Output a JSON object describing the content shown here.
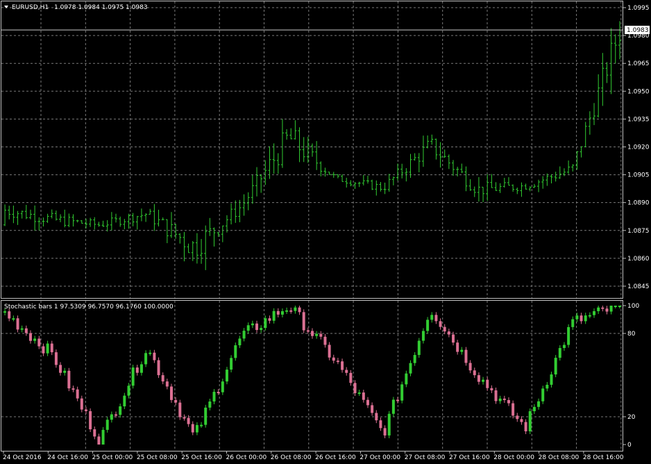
{
  "header": {
    "symbol_label": "EURUSD,H1",
    "ohlc_label": "1.0978 1.0984 1.0975 1.0983",
    "menu_icon": "triangle-down-icon"
  },
  "price_panel": {
    "current_price_label": "1.0983",
    "current_price": 1.0983,
    "y_ticks": [
      {
        "value": 1.0995,
        "label": "1.0995"
      },
      {
        "value": 1.098,
        "label": "1.0980"
      },
      {
        "value": 1.0965,
        "label": "1.0965"
      },
      {
        "value": 1.095,
        "label": "1.0950"
      },
      {
        "value": 1.0935,
        "label": "1.0935"
      },
      {
        "value": 1.092,
        "label": "1.0920"
      },
      {
        "value": 1.0905,
        "label": "1.0905"
      },
      {
        "value": 1.089,
        "label": "1.0890"
      },
      {
        "value": 1.0875,
        "label": "1.0875"
      },
      {
        "value": 1.086,
        "label": "1.0860"
      },
      {
        "value": 1.0845,
        "label": "1.0845"
      }
    ]
  },
  "stoch_panel": {
    "title": "Stochastic bars 1 97.5309 96.7570 96.1760 100.0000",
    "y_ticks": [
      {
        "value": 100,
        "label": "100"
      },
      {
        "value": 80,
        "label": "80"
      },
      {
        "value": 20,
        "label": "20"
      },
      {
        "value": 0,
        "label": "0"
      }
    ]
  },
  "x_axis": {
    "labels": [
      "24 Oct 2016",
      "24 Oct 16:00",
      "25 Oct 00:00",
      "25 Oct 08:00",
      "25 Oct 16:00",
      "26 Oct 00:00",
      "26 Oct 08:00",
      "26 Oct 16:00",
      "27 Oct 00:00",
      "27 Oct 08:00",
      "27 Oct 16:00",
      "28 Oct 00:00",
      "28 Oct 08:00",
      "28 Oct 16:00"
    ]
  },
  "colors": {
    "background": "#000000",
    "grid": "#7a7a7a",
    "border": "#c0c0c0",
    "price_bar": "#32cd32",
    "stoch_up": "#32cd32",
    "stoch_down": "#db7093",
    "text": "#ffffff"
  },
  "chart_data": [
    {
      "type": "bar",
      "x": [
        "24 Oct 2016",
        "24 Oct 16:00",
        "25 Oct 00:00",
        "25 Oct 08:00",
        "25 Oct 16:00",
        "26 Oct 00:00",
        "26 Oct 08:00",
        "26 Oct 16:00",
        "27 Oct 00:00",
        "27 Oct 08:00",
        "27 Oct 16:00",
        "28 Oct 00:00",
        "28 Oct 08:00",
        "28 Oct 16:00"
      ],
      "close": [
        1.0886,
        1.0881,
        1.0878,
        1.0884,
        1.0866,
        1.0888,
        1.0925,
        1.0903,
        1.0898,
        1.0921,
        1.0897,
        1.0899,
        1.0908,
        1.0983
      ],
      "high": [
        1.0895,
        1.0894,
        1.0885,
        1.0892,
        1.0904,
        1.0894,
        1.0944,
        1.0912,
        1.0911,
        1.0942,
        1.0907,
        1.0907,
        1.0925,
        1.0993
      ],
      "low": [
        1.0869,
        1.0871,
        1.087,
        1.0871,
        1.085,
        1.0873,
        1.0885,
        1.09,
        1.0893,
        1.0907,
        1.088,
        1.0891,
        1.09,
        1.093
      ],
      "ylim": [
        1.0839,
        1.0998
      ]
    },
    {
      "type": "bar",
      "x": [
        "24 Oct 2016",
        "24 Oct 16:00",
        "25 Oct 00:00",
        "25 Oct 08:00",
        "25 Oct 16:00",
        "26 Oct 00:00",
        "26 Oct 08:00",
        "26 Oct 16:00",
        "27 Oct 00:00",
        "27 Oct 08:00",
        "27 Oct 16:00",
        "28 Oct 00:00",
        "28 Oct 08:00",
        "28 Oct 16:00"
      ],
      "values": [
        95,
        65,
        3,
        70,
        5,
        78,
        100,
        60,
        8,
        98,
        50,
        12,
        88,
        100
      ],
      "ylim": [
        0,
        100
      ]
    }
  ]
}
